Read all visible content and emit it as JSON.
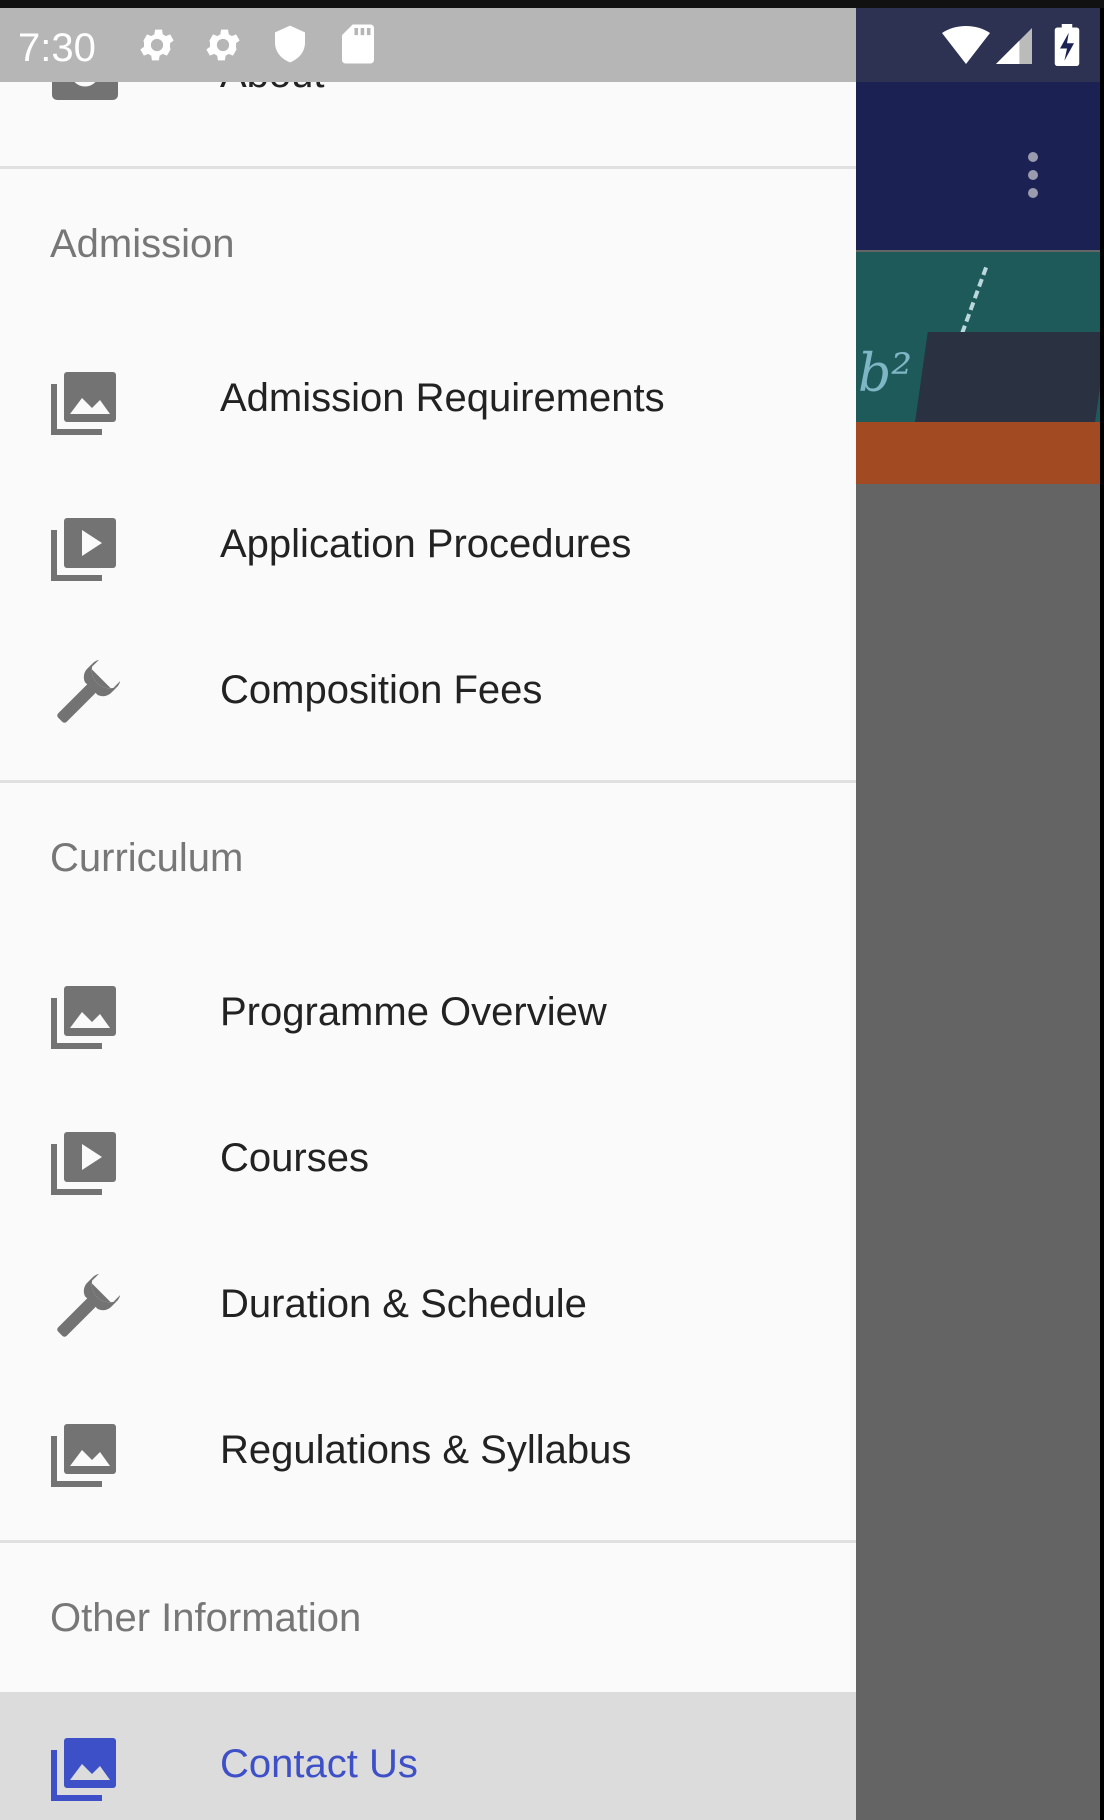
{
  "status_bar": {
    "time": "7:30",
    "icons": [
      "settings-icon",
      "settings-icon",
      "shield-icon",
      "sd-card-icon",
      "wifi-icon",
      "signal-icon",
      "battery-charging-icon"
    ]
  },
  "app_bar": {
    "overflow_icon": "more-vert-icon"
  },
  "drawer": {
    "top_item": {
      "label": "About",
      "icon": "camera-icon"
    },
    "sections": [
      {
        "header": "Admission",
        "items": [
          {
            "label": "Admission Requirements",
            "icon": "photo-library-icon"
          },
          {
            "label": "Application Procedures",
            "icon": "video-library-icon"
          },
          {
            "label": "Composition Fees",
            "icon": "wrench-icon"
          }
        ]
      },
      {
        "header": "Curriculum",
        "items": [
          {
            "label": "Programme Overview",
            "icon": "photo-library-icon"
          },
          {
            "label": "Courses",
            "icon": "video-library-icon"
          },
          {
            "label": "Duration & Schedule",
            "icon": "wrench-icon"
          },
          {
            "label": "Regulations & Syllabus",
            "icon": "photo-library-icon"
          }
        ]
      },
      {
        "header": "Other Information",
        "items": [
          {
            "label": "Contact Us",
            "icon": "photo-library-icon",
            "selected": true
          }
        ]
      }
    ]
  },
  "colors": {
    "toolbar": "#1b2153",
    "drawer_bg": "#fafafa",
    "selected_bg": "#dcdcdc",
    "selected_text": "#3d50c8",
    "icon_gray": "#737373"
  }
}
